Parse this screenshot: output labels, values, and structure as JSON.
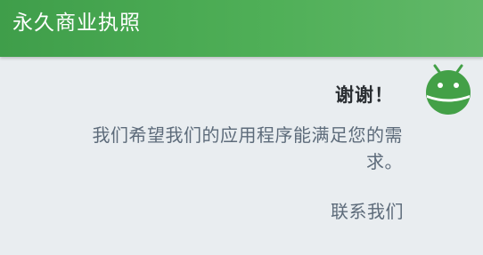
{
  "app": {
    "title": "永久商业执照"
  },
  "dialog": {
    "heading": "谢谢！",
    "message": "我们希望我们的应用程序能满足您的需求。",
    "contact_link": "联系我们"
  },
  "avatar": {
    "icon": "android-robot-icon",
    "color": "#43a047"
  }
}
